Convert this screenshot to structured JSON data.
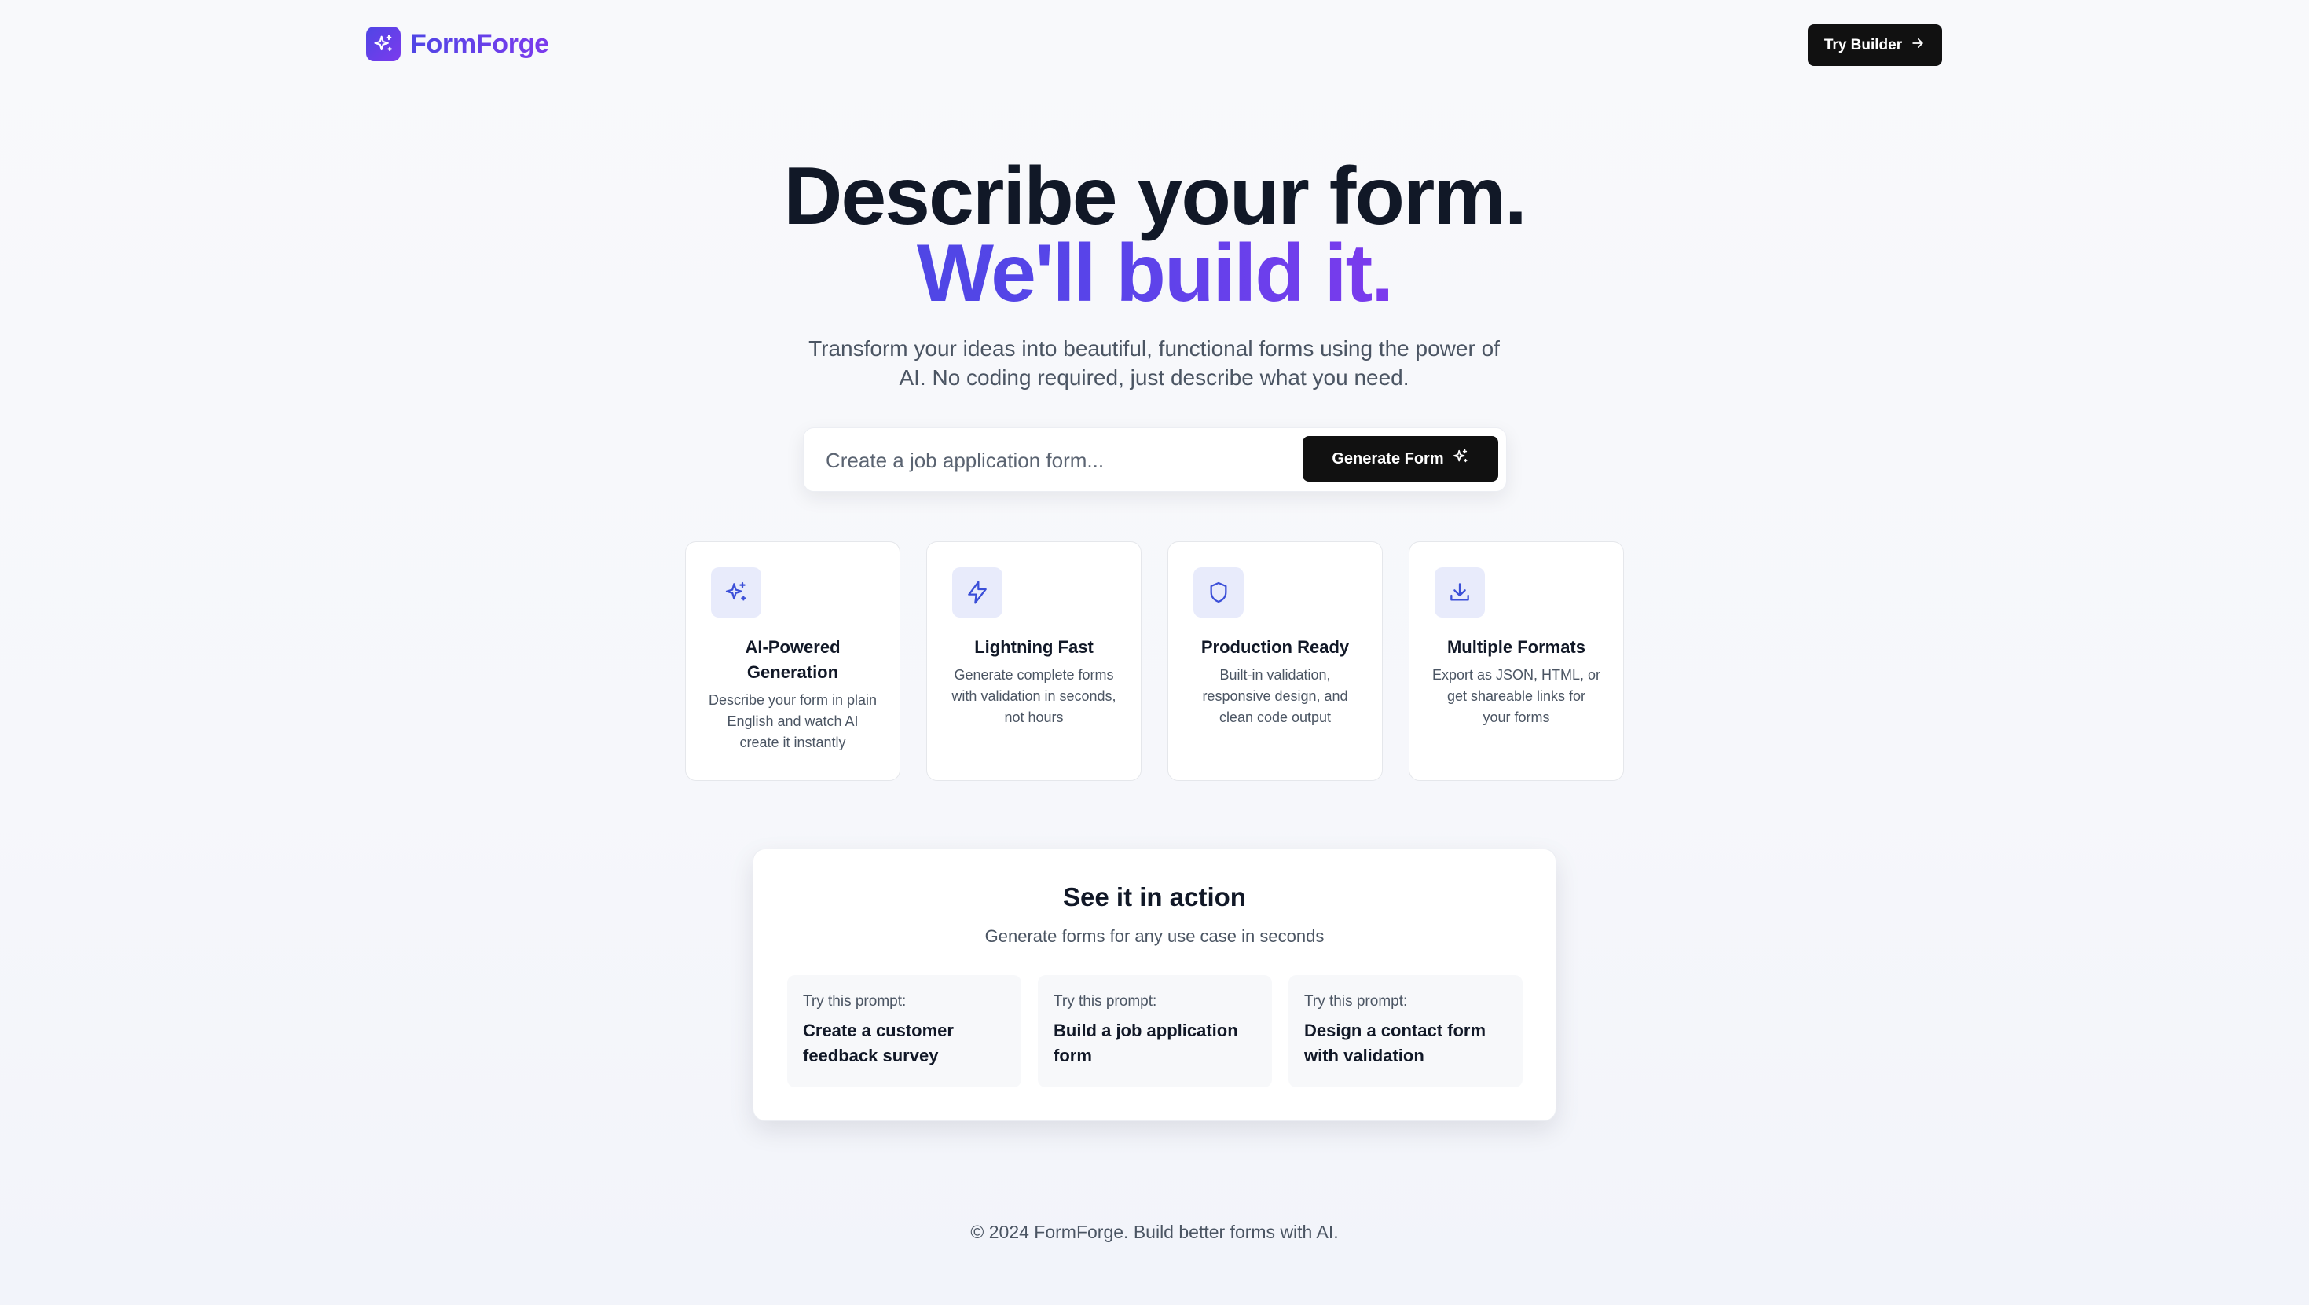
{
  "header": {
    "brand_name": "FormForge",
    "brand_icon": "sparkles-icon",
    "try_builder_label": "Try Builder",
    "try_builder_icon": "arrow-right-icon"
  },
  "hero": {
    "headline_line1": "Describe your form.",
    "headline_line2": "We'll build it.",
    "subtitle": "Transform your ideas into beautiful, functional forms using the power of AI. No coding required, just describe what you need."
  },
  "prompt_bar": {
    "placeholder": "Create a job application form...",
    "value": "",
    "generate_label": "Generate Form",
    "generate_icon": "sparkles-icon"
  },
  "features": [
    {
      "icon": "sparkles-icon",
      "title": "AI-Powered Generation",
      "description": "Describe your form in plain English and watch AI create it instantly"
    },
    {
      "icon": "lightning-icon",
      "title": "Lightning Fast",
      "description": "Generate complete forms with validation in seconds, not hours"
    },
    {
      "icon": "shield-icon",
      "title": "Production Ready",
      "description": "Built-in validation, responsive design, and clean code output"
    },
    {
      "icon": "download-icon",
      "title": "Multiple Formats",
      "description": "Export as JSON, HTML, or get shareable links for your forms"
    }
  ],
  "demo": {
    "title": "See it in action",
    "subtitle": "Generate forms for any use case in seconds",
    "prompts": [
      {
        "label": "Try this prompt:",
        "text": "Create a customer feedback survey"
      },
      {
        "label": "Try this prompt:",
        "text": "Build a job application form"
      },
      {
        "label": "Try this prompt:",
        "text": "Design a contact form with validation"
      }
    ]
  },
  "footer": {
    "text": "© 2024 FormForge. Build better forms with AI."
  },
  "colors": {
    "accent_start": "#4f46e5",
    "accent_end": "#7c3aed",
    "dark_button": "#111111",
    "icon_tile_bg": "#e8ebfb",
    "icon_stroke": "#3b4fd8"
  }
}
